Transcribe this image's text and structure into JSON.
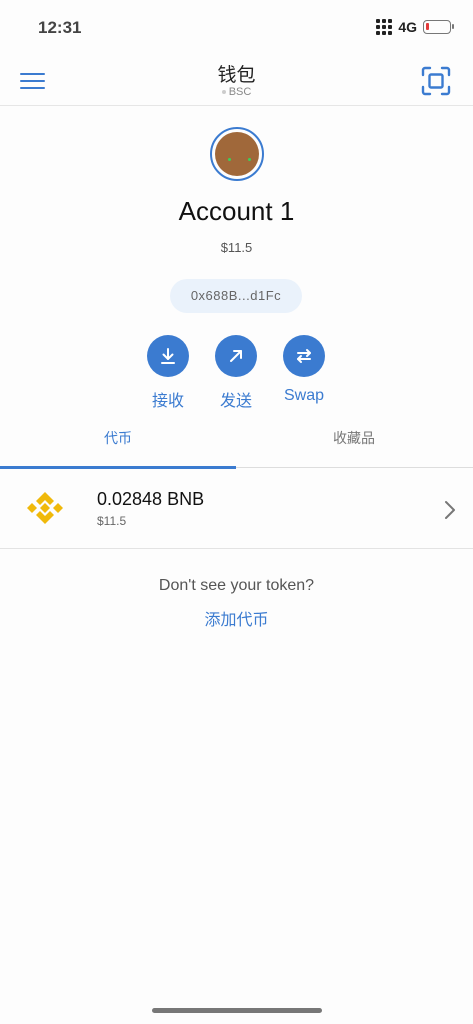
{
  "status": {
    "time": "12:31",
    "network": "4G",
    "battery_level": 0.15
  },
  "header": {
    "title": "钱包",
    "network": "BSC"
  },
  "account": {
    "name": "Account 1",
    "balance": "$11.5",
    "address": "0x688B...d1Fc"
  },
  "actions": [
    {
      "label": "接收",
      "icon": "download-icon"
    },
    {
      "label": "发送",
      "icon": "arrow-up-right-icon"
    },
    {
      "label": "Swap",
      "icon": "swap-icon"
    }
  ],
  "tabs": [
    {
      "label": "代币",
      "active": true
    },
    {
      "label": "收藏品",
      "active": false
    }
  ],
  "tokens": [
    {
      "amount": "0.02848 BNB",
      "fiat": "$11.5",
      "icon": "bnb-logo-icon"
    }
  ],
  "footer": {
    "prompt": "Don't see your token?",
    "add_link": "添加代币"
  },
  "colors": {
    "accent": "#3b7bd0",
    "bnb": "#f0b90b"
  }
}
